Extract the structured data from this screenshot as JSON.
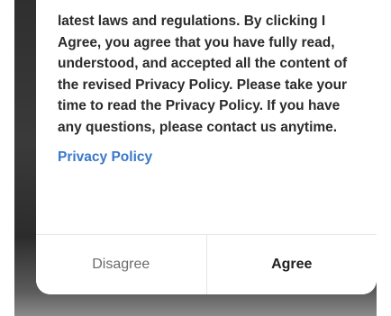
{
  "dialog": {
    "body_text": "latest laws and regulations. By clicking I Agree, you agree that you have fully read, understood, and accepted all the content of the revised Privacy Policy. Please take your time to read the Privacy Policy. If you have any questions, please contact us anytime.",
    "link_label": "Privacy Policy",
    "buttons": {
      "disagree_label": "Disagree",
      "agree_label": "Agree"
    }
  },
  "colors": {
    "link": "#3a78c9",
    "text": "#2b2b2b",
    "secondary_button_text": "#6b6b6b",
    "primary_button_text": "#1f1f1f"
  }
}
